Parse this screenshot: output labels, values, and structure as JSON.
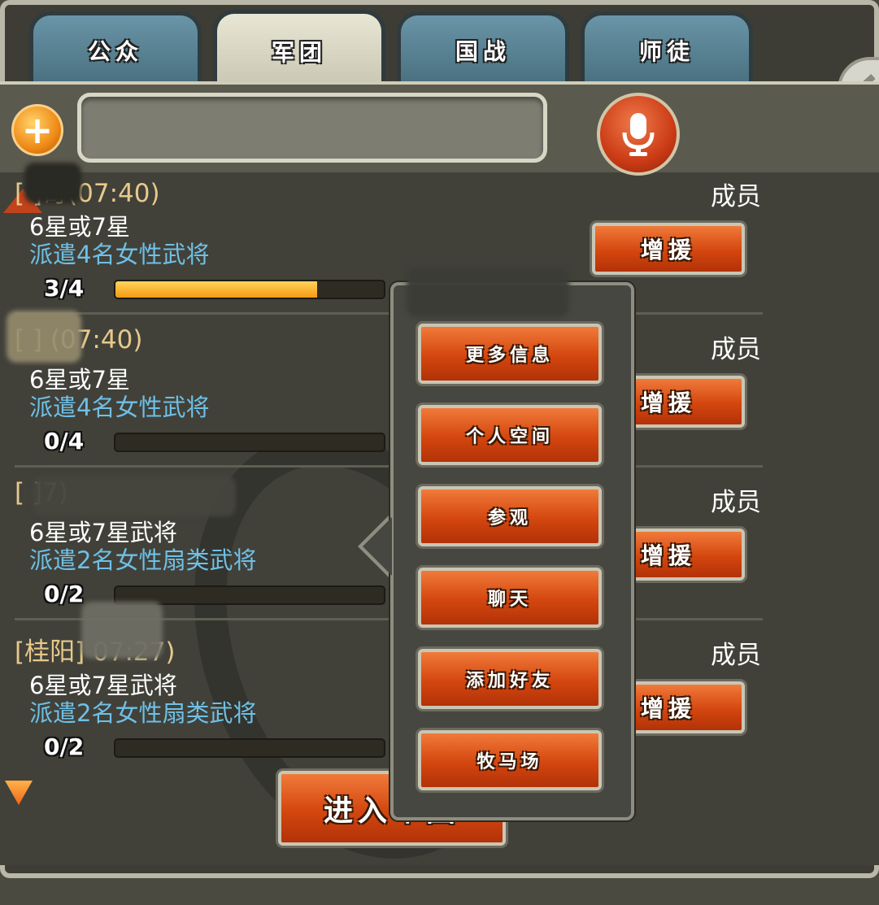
{
  "tabs": [
    {
      "label": "公众",
      "active": false
    },
    {
      "label": "军团",
      "active": true
    },
    {
      "label": "国战",
      "active": false
    },
    {
      "label": "师徒",
      "active": false
    }
  ],
  "chat": {
    "input_value": ""
  },
  "entries": [
    {
      "title": "[  ]奇(07:40)",
      "requirement": "6星或7星",
      "task": "派遣4名女性武将",
      "progress_text": "3/4",
      "progress": 0.75,
      "role": "成员",
      "button": "增援"
    },
    {
      "title": "[  ]      (07:40)",
      "requirement": "6星或7星",
      "task": "派遣4名女性武将",
      "progress_text": "0/4",
      "progress": 0,
      "role": "成员",
      "button": "增援"
    },
    {
      "title": "[           ]7)",
      "requirement": "6星或7星武将",
      "task": "派遣2名女性扇类武将",
      "progress_text": "0/2",
      "progress": 0,
      "role": "成员",
      "button": "增援"
    },
    {
      "title": "[桂阳]        07:27)",
      "requirement": "6星或7星武将",
      "task": "派遣2名女性扇类武将",
      "progress_text": "0/2",
      "progress": 0,
      "role": "成员",
      "button": "增援"
    }
  ],
  "enter_button": "进入军团",
  "context_menu": [
    "更多信息",
    "个人空间",
    "参观",
    "聊天",
    "添加好友",
    "牧马场"
  ],
  "colors": {
    "accent_red": "#d4460f",
    "task_blue": "#6fc0e6",
    "title_gold": "#e8c98a",
    "progress_orange": "#f59a12"
  },
  "icons": {
    "add": "plus-icon",
    "voice": "microphone-icon",
    "collapse": "chevron-left-icon"
  }
}
